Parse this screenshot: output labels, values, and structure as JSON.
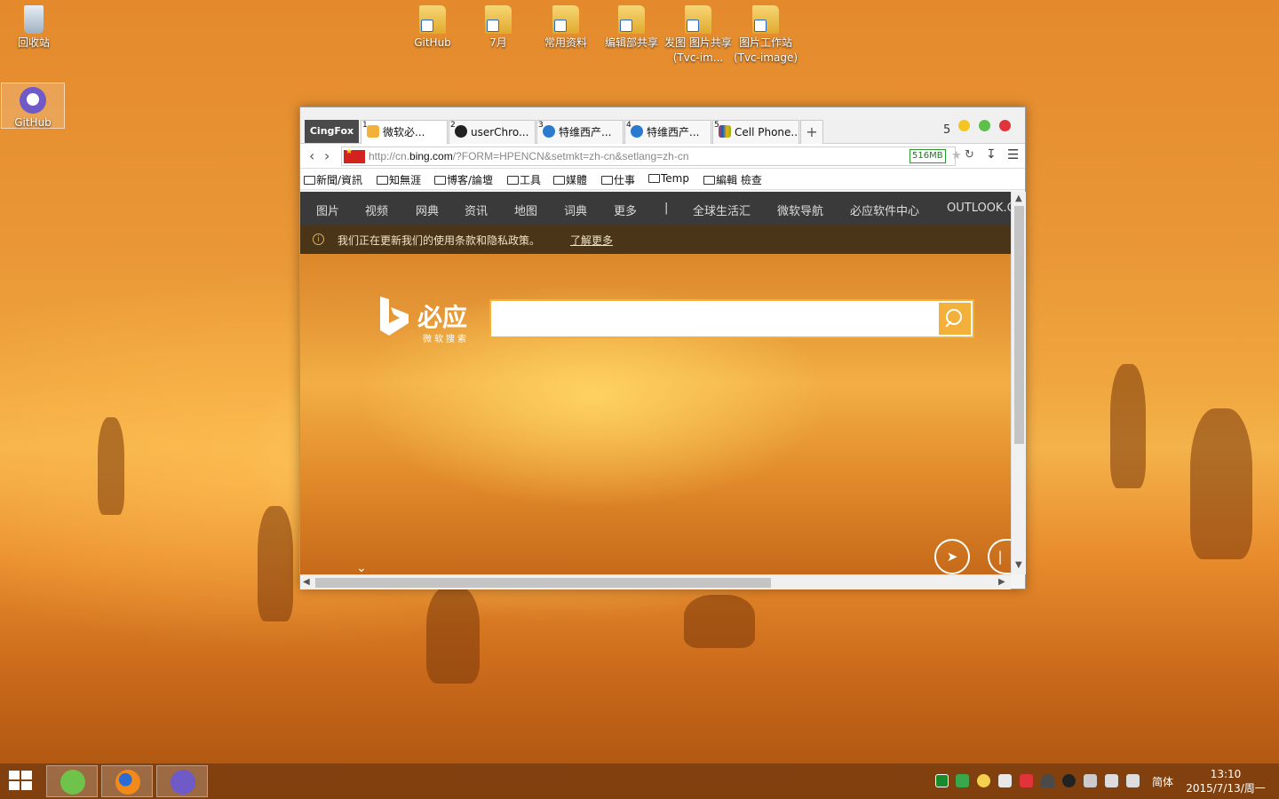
{
  "desktop": {
    "icons": [
      {
        "label": "回收站"
      },
      {
        "label": "GitHub"
      },
      {
        "label": "GitHub"
      },
      {
        "label": "7月"
      },
      {
        "label": "常用资料"
      },
      {
        "label": "编辑部共享"
      },
      {
        "label": "发图 图片共享 (Tvc-im..."
      },
      {
        "label": "图片工作站 (Tvc-image)"
      }
    ]
  },
  "browser": {
    "brand": "CingFox",
    "tabs": [
      {
        "num": "1",
        "label": "微软必...",
        "icon": "bing-icon"
      },
      {
        "num": "2",
        "label": "userChro...",
        "icon": "github-icon"
      },
      {
        "num": "3",
        "label": "特维西产...",
        "icon": "t-icon"
      },
      {
        "num": "4",
        "label": "特维西产...",
        "icon": "t-icon"
      },
      {
        "num": "5",
        "label": "Cell Phone...",
        "icon": "ebay-icon"
      }
    ],
    "new_tab": "+",
    "tab_count": "5",
    "url_prefix": "http://cn.",
    "url_host": "bing.com",
    "url_rest": "/?FORM=HPENCN&setmkt=zh-cn&setlang=zh-cn",
    "memory": "516MB",
    "bookmarks": [
      "新聞/資訊",
      "知無涯",
      "博客/論壇",
      "工具",
      "媒體",
      "仕事",
      "Temp",
      "編輯 檢查"
    ]
  },
  "bing": {
    "nav": [
      "图片",
      "视频",
      "网典",
      "资讯",
      "地图",
      "词典",
      "更多",
      "|",
      "全球生活汇",
      "微软导航",
      "必应软件中心",
      "OUTLOOK.C"
    ],
    "notice_text": "我们正在更新我们的使用条款和隐私政策。",
    "notice_link": "了解更多",
    "logo_name": "必应",
    "logo_sub": "微软搜索",
    "search_value": ""
  },
  "taskbar": {
    "ime": "简体",
    "time": "13:10",
    "date": "2015/7/13/周一"
  },
  "colors": {
    "accent": "#f3b03a",
    "bing_nav": "#3a3a3a",
    "notice_bg": "#4a3518",
    "memory_green": "#1a7a1a"
  }
}
